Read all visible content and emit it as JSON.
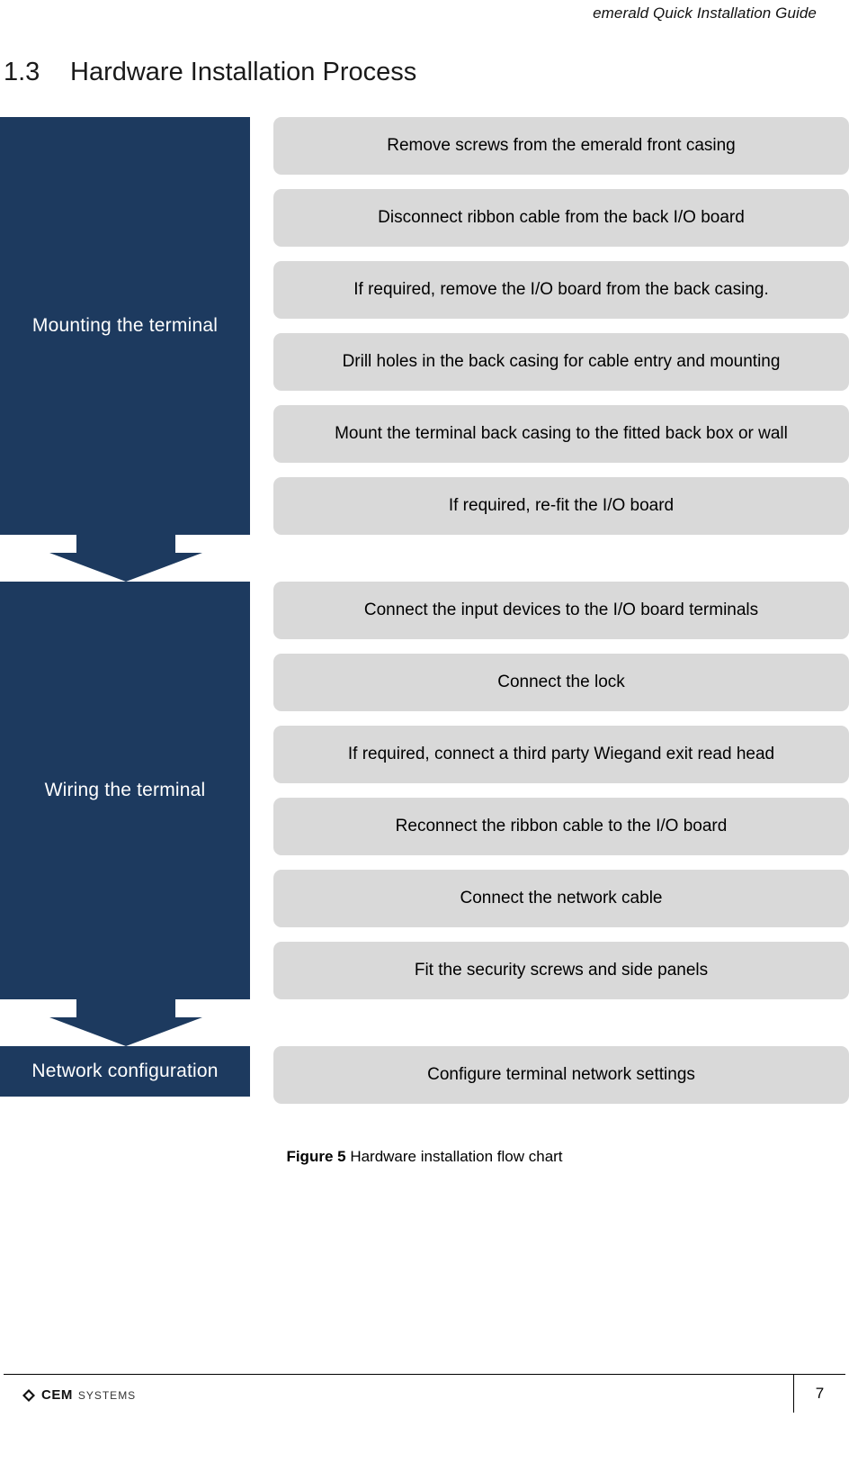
{
  "header": {
    "running_title": "emerald Quick Installation Guide"
  },
  "section": {
    "number": "1.3",
    "title": "Hardware Installation Process"
  },
  "flowchart": {
    "stages": [
      {
        "label": "Mounting the terminal",
        "steps": [
          "Remove screws from the emerald front casing",
          "Disconnect ribbon cable from the back I/O board",
          "If required, remove the I/O board from the back casing.",
          "Drill holes in the back casing for cable entry and mounting",
          "Mount the terminal back casing to the fitted back box or wall",
          "If required, re-fit the I/O board"
        ]
      },
      {
        "label": "Wiring the terminal",
        "steps": [
          "Connect the input devices to the I/O board terminals",
          "Connect the lock",
          "If required, connect a third party Wiegand exit read head",
          "Reconnect the ribbon cable to the I/O board",
          "Connect the network cable",
          "Fit the security screws and side panels"
        ]
      },
      {
        "label": "Network configuration",
        "steps": [
          "Configure terminal network settings"
        ]
      }
    ],
    "colors": {
      "stage_fill": "#1d3a5f",
      "step_fill": "#d9d9d9",
      "arrow_fill": "#1d3a5f"
    }
  },
  "figure": {
    "label": "Figure 5",
    "caption": "Hardware installation flow chart"
  },
  "footer": {
    "logo_primary": "CEM",
    "logo_secondary": "SYSTEMS",
    "page_number": "7"
  }
}
